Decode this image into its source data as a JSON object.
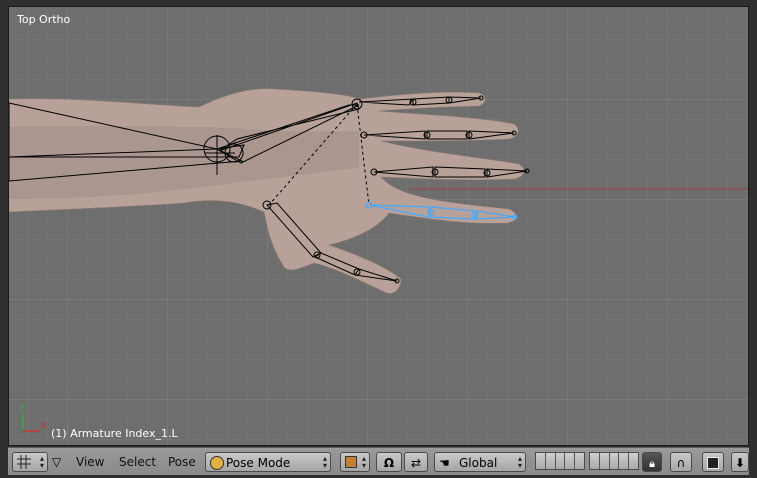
{
  "viewport": {
    "view_label": "Top Ortho",
    "object_info": "(1) Armature Index_1.L",
    "selected_bone_color": "#44aaff",
    "bone_color": "#000000",
    "skin_color": "#b8a29a"
  },
  "header": {
    "menu_view": "View",
    "menu_select": "Select",
    "menu_pose": "Pose",
    "mode_label": "Pose Mode",
    "orientation_label": "Global",
    "editor_icon": "grid-icon",
    "mode_icon": "pose-mode-icon",
    "pivot_icon": "pivot-point-icon",
    "manipulator_icon": "magnet-omega-icon",
    "transform_icon": "hand-icon",
    "lock_icon": "lock-icon",
    "render_icon": "render-icon",
    "export_icon": "down-arrow-icon"
  }
}
